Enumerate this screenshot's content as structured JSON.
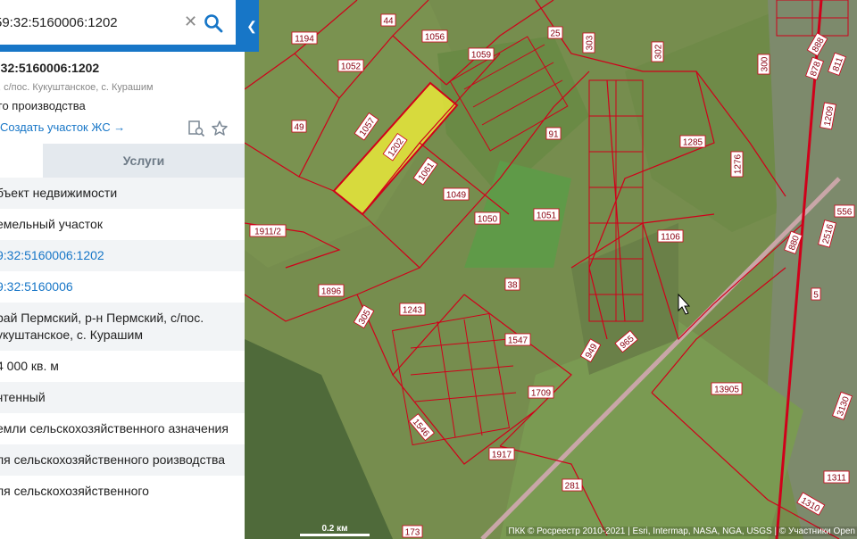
{
  "search": {
    "value": "59:32:5160006:1202",
    "clear_icon": "close-icon",
    "search_icon": "search-icon"
  },
  "collapse_icon": "chevron-left-icon",
  "card": {
    "title": ":32:5160006:1202",
    "address_line": ", с/пос. Кукуштанское, с. Курашим",
    "use_line": "го производства",
    "create_link": "Создать участок ЖС →",
    "tab_services": "Услуги",
    "rows": [
      "бъект недвижимости",
      "емельный участок",
      "9:32:5160006:1202",
      "9:32:5160006",
      "рай Пермский, р-н Пермский, с/пос. укуштанское, с. Курашим",
      "4 000 кв. м",
      "чтенный",
      "емли сельскохозяйственного азначения",
      "ля сельскохозяйственного роизводства",
      "ля сельскохозяйственного"
    ]
  },
  "map": {
    "highlight_color": "#e8e63a",
    "boundary_color": "#d0001a",
    "parcel_labels": [
      "1194",
      "44",
      "1056",
      "1059",
      "25",
      "303",
      "302",
      "300",
      "888",
      "878",
      "811",
      "1052",
      "49",
      "1057",
      "1202",
      "91",
      "1285",
      "1209",
      "1061",
      "1049",
      "1276",
      "556",
      "1911/2",
      "1050",
      "1051",
      "1106",
      "2516",
      "880",
      "1896",
      "38",
      "5",
      "305",
      "1243",
      "1547",
      "949",
      "965",
      "13905",
      "1709",
      "3130",
      "1546",
      "1917",
      "1311",
      "281",
      "1310",
      "173"
    ],
    "scale_label": "0.2 км",
    "attribution": "ПКК © Росреестр 2010-2021 | Esri, Intermap, NASA, NGA, USGS | © Участники Open"
  }
}
